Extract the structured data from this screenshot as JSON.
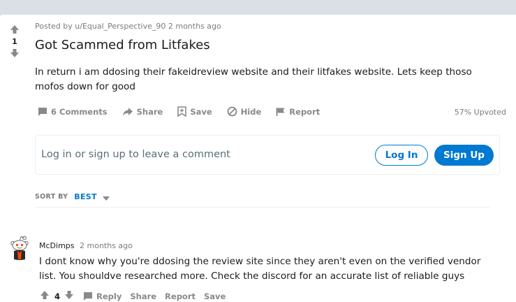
{
  "post": {
    "posted_by_prefix": "Posted by",
    "author": "u/Equal_Perspective_90",
    "time": "2 months ago",
    "score": "1",
    "title": "Got Scammed from Litfakes",
    "body": "In return i am ddosing their fakeidreview website and their litfakes website. Lets keep thoso mofos down for good",
    "actions": {
      "comments": "6 Comments",
      "share": "Share",
      "save": "Save",
      "hide": "Hide",
      "report": "Report"
    },
    "upvoted": "57% Upvoted"
  },
  "comment_box": {
    "prompt": "Log in or sign up to leave a comment",
    "login_label": "Log In",
    "signup_label": "Sign Up",
    "accent_color": "#0079d3"
  },
  "sort": {
    "label": "SORT BY",
    "value": "BEST"
  },
  "comments": [
    {
      "author": "McDimps",
      "time": "2 months ago",
      "body": "I dont know why you're ddosing the review site since they aren't even on the verified vendor list. You shouldve researched more. Check the discord for an accurate list of reliable guys",
      "score": "4",
      "actions": {
        "reply": "Reply",
        "share": "Share",
        "report": "Report",
        "save": "Save"
      }
    }
  ],
  "icons": {
    "upvote": "upvote-arrow-icon",
    "downvote": "downvote-arrow-icon",
    "comments": "comment-bubble-icon",
    "share": "share-arrow-icon",
    "save": "bookmark-plus-icon",
    "hide": "hide-circle-slash-icon",
    "report": "flag-icon",
    "avatar": "snoo-avatar-icon"
  }
}
